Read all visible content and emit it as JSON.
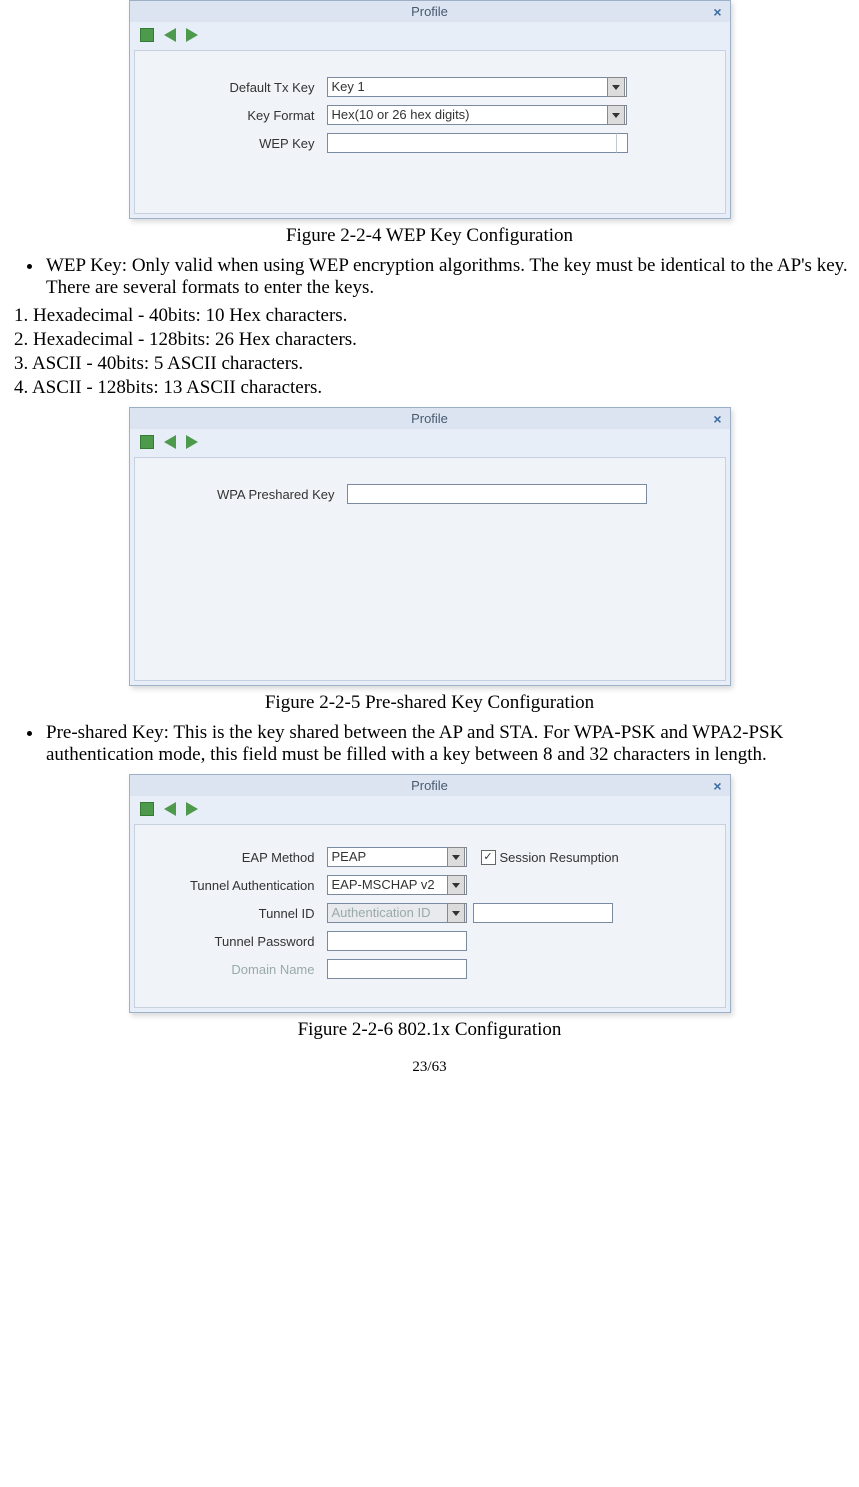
{
  "dialog1": {
    "title": "Profile",
    "fields": {
      "tx_key_label": "Default Tx Key",
      "tx_key_value": "Key 1",
      "key_format_label": "Key Format",
      "key_format_value": "Hex(10 or 26 hex digits)",
      "wep_key_label": "WEP Key",
      "wep_key_value": ""
    }
  },
  "caption1": "Figure 2-2-4 WEP Key Configuration",
  "bullet1": "WEP Key: Only valid when using WEP encryption algorithms. The key must be identical to the AP's key. There are several formats to enter the keys.",
  "num1": "1. Hexadecimal - 40bits: 10 Hex characters.",
  "num2": "2. Hexadecimal - 128bits: 26 Hex characters.",
  "num3": "3. ASCII - 40bits: 5 ASCII characters.",
  "num4": "4. ASCII - 128bits: 13 ASCII characters.",
  "dialog2": {
    "title": "Profile",
    "fields": {
      "psk_label": "WPA Preshared Key",
      "psk_value": ""
    }
  },
  "caption2": "Figure 2-2-5 Pre-shared Key Configuration",
  "bullet2": "Pre-shared Key: This is the key shared between the AP and STA. For WPA-PSK and WPA2-PSK authentication mode, this field must be filled with a key between 8 and 32 characters in length.",
  "dialog3": {
    "title": "Profile",
    "fields": {
      "eap_label": "EAP Method",
      "eap_value": "PEAP",
      "session_label": "Session Resumption",
      "session_checked": "✓",
      "tunnel_auth_label": "Tunnel Authentication",
      "tunnel_auth_value": "EAP-MSCHAP v2",
      "tunnel_id_label": "Tunnel ID",
      "tunnel_id_value": "Authentication ID",
      "tunnel_id_text": "",
      "tunnel_pw_label": "Tunnel Password",
      "tunnel_pw_value": "",
      "domain_label": "Domain Name",
      "domain_value": ""
    }
  },
  "caption3": "Figure 2-2-6 802.1x Configuration",
  "pagenum": "23/63"
}
